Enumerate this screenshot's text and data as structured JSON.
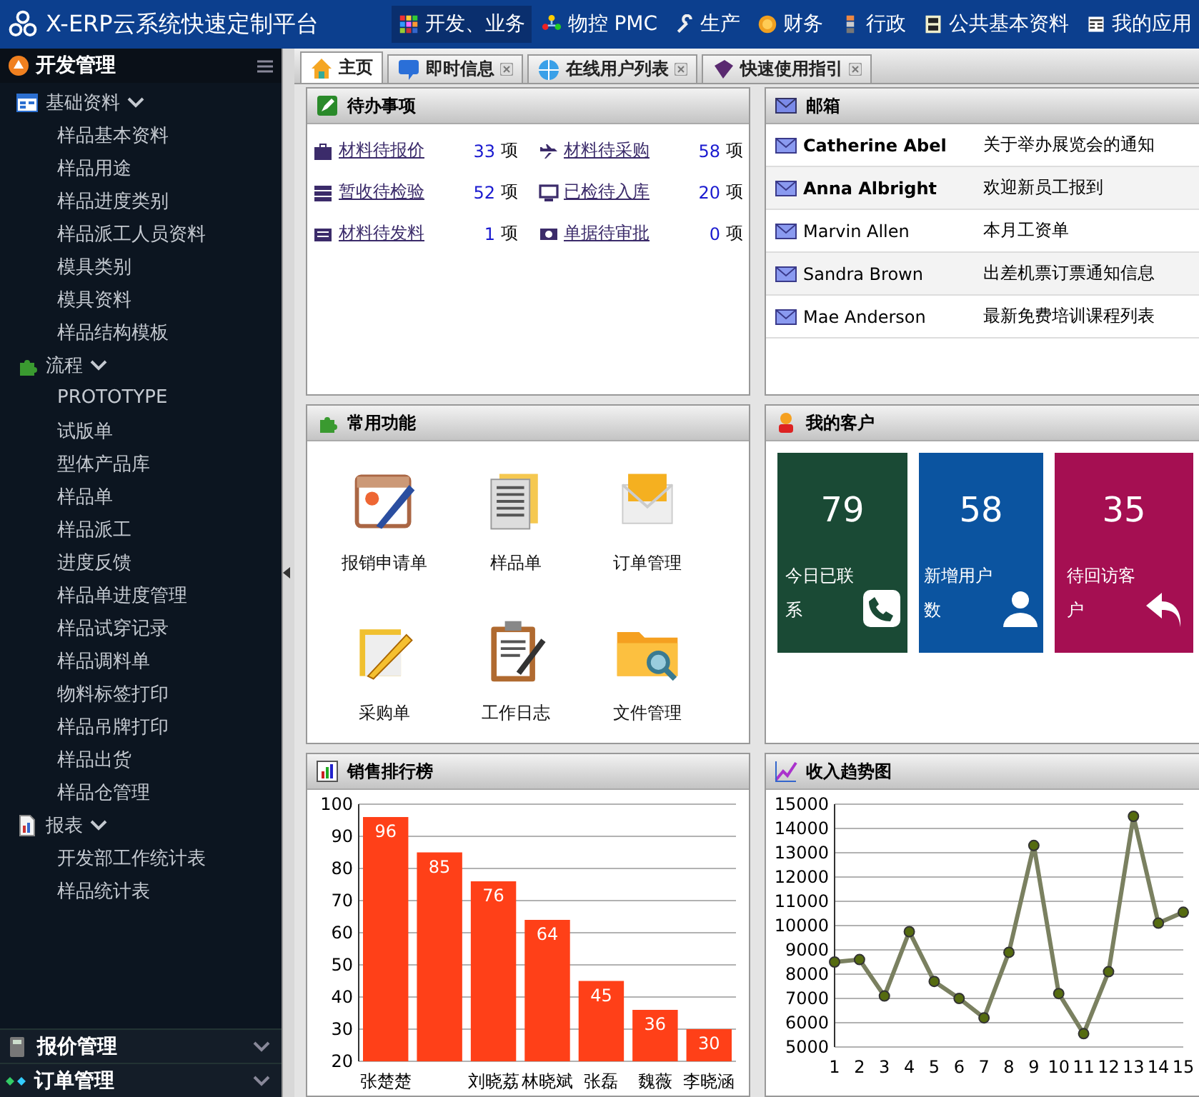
{
  "app_title": "X-ERP云系统快速定制平台",
  "top_menu": [
    {
      "label": "开发、业务",
      "selected": true
    },
    {
      "label": "物控 PMC",
      "selected": false
    },
    {
      "label": "生产",
      "selected": false
    },
    {
      "label": "财务",
      "selected": false
    },
    {
      "label": "行政",
      "selected": false
    },
    {
      "label": "公共基本资料",
      "selected": false
    },
    {
      "label": "我的应用",
      "selected": false
    }
  ],
  "sidebar": {
    "title": "开发管理",
    "groups": [
      {
        "label": "基础资料",
        "expanded": true,
        "children": [
          {
            "label": "样品基本资料"
          },
          {
            "label": "样品用途"
          },
          {
            "label": "样品进度类别"
          },
          {
            "label": "样品派工人员资料"
          },
          {
            "label": "模具类别"
          },
          {
            "label": "模具资料"
          },
          {
            "label": "样品结构模板"
          }
        ]
      },
      {
        "label": "流程",
        "expanded": true,
        "children": [
          {
            "label": "PROTOTYPE"
          },
          {
            "label": "试版单"
          },
          {
            "label": "型体产品库"
          },
          {
            "label": "样品单"
          },
          {
            "label": "样品派工"
          },
          {
            "label": "进度反馈"
          },
          {
            "label": "样品单进度管理"
          },
          {
            "label": "样品试穿记录"
          },
          {
            "label": "样品调料单"
          },
          {
            "label": "物料标签打印"
          },
          {
            "label": "样品吊牌打印"
          },
          {
            "label": "样品出货"
          },
          {
            "label": "样品仓管理"
          }
        ]
      },
      {
        "label": "报表",
        "expanded": true,
        "children": [
          {
            "label": "开发部工作统计表"
          },
          {
            "label": "样品统计表"
          }
        ]
      }
    ],
    "sections": [
      {
        "label": "报价管理",
        "expanded": false
      },
      {
        "label": "订单管理",
        "expanded": false
      }
    ]
  },
  "tabs": [
    {
      "label": "主页",
      "selected": true,
      "closable": false
    },
    {
      "label": "即时信息",
      "selected": false,
      "closable": true
    },
    {
      "label": "在线用户列表",
      "selected": false,
      "closable": true
    },
    {
      "label": "快速使用指引",
      "selected": false,
      "closable": true
    }
  ],
  "todo": {
    "title": "待办事项",
    "items": [
      {
        "label": "材料待报价",
        "count": "33",
        "unit": "项"
      },
      {
        "label": "材料待采购",
        "count": "58",
        "unit": "项"
      },
      {
        "label": "暂收待检验",
        "count": "52",
        "unit": "项"
      },
      {
        "label": "已检待入库",
        "count": "20",
        "unit": "项"
      },
      {
        "label": "材料待发料",
        "count": "1",
        "unit": "项"
      },
      {
        "label": "单据待审批",
        "count": "0",
        "unit": "项"
      }
    ]
  },
  "mailbox": {
    "title": "邮箱",
    "messages": [
      {
        "sender": "Catherine Abel",
        "subject": "关于举办展览会的通知",
        "unread": true
      },
      {
        "sender": "Anna Albright",
        "subject": "欢迎新员工报到",
        "unread": true
      },
      {
        "sender": "Marvin Allen",
        "subject": "本月工资单",
        "unread": false
      },
      {
        "sender": "Sandra Brown",
        "subject": "出差机票订票通知信息",
        "unread": false
      },
      {
        "sender": "Mae Anderson",
        "subject": "最新免费培训课程列表",
        "unread": false
      }
    ]
  },
  "shortcuts": {
    "title": "常用功能",
    "items": [
      {
        "label": "报销申请单"
      },
      {
        "label": "样品单"
      },
      {
        "label": "订单管理"
      },
      {
        "label": "采购单"
      },
      {
        "label": "工作日志"
      },
      {
        "label": "文件管理"
      }
    ]
  },
  "customers": {
    "title": "我的客户",
    "tiles": [
      {
        "value": "79",
        "label": "今日已联系",
        "color": "#1a4a35"
      },
      {
        "value": "58",
        "label": "新增用户数",
        "color": "#0b54a0"
      },
      {
        "value": "35",
        "label": "待回访客户",
        "color": "#a50f52"
      }
    ]
  },
  "sales_ranking": {
    "title": "销售排行榜",
    "chart_data": {
      "type": "bar",
      "categories": [
        "张楚楚",
        null,
        "刘晓荔",
        "林晓斌",
        "张磊",
        "魏薇",
        "李晓涵"
      ],
      "series": [
        {
          "color": "#ff4018",
          "values": [
            96,
            85,
            76,
            64,
            45,
            36,
            30
          ]
        }
      ],
      "grid": true,
      "ylim": [
        20,
        100
      ],
      "yticks": [
        20,
        30,
        40,
        50,
        60,
        70,
        80,
        90,
        100
      ],
      "data_labels": true
    }
  },
  "income_trend": {
    "title": "收入趋势图",
    "chart_data": {
      "type": "line",
      "x": [
        1,
        2,
        3,
        4,
        5,
        6,
        7,
        8,
        9,
        10,
        11,
        12,
        13,
        14,
        15
      ],
      "series": [
        {
          "color": "#7a8060",
          "marker": true,
          "values": [
            8500,
            8600,
            7100,
            9750,
            7700,
            7000,
            6200,
            8900,
            13300,
            7200,
            5550,
            8100,
            14500,
            10100,
            10550
          ]
        }
      ],
      "grid": true,
      "xlim": [
        1,
        15
      ],
      "ylim": [
        5000,
        15000
      ],
      "yticks": [
        5000,
        6000,
        7000,
        8000,
        9000,
        10000,
        11000,
        12000,
        13000,
        14000,
        15000
      ],
      "xticks": [
        1,
        2,
        3,
        4,
        5,
        6,
        7,
        8,
        9,
        10,
        11,
        12,
        13,
        14,
        15
      ]
    }
  }
}
